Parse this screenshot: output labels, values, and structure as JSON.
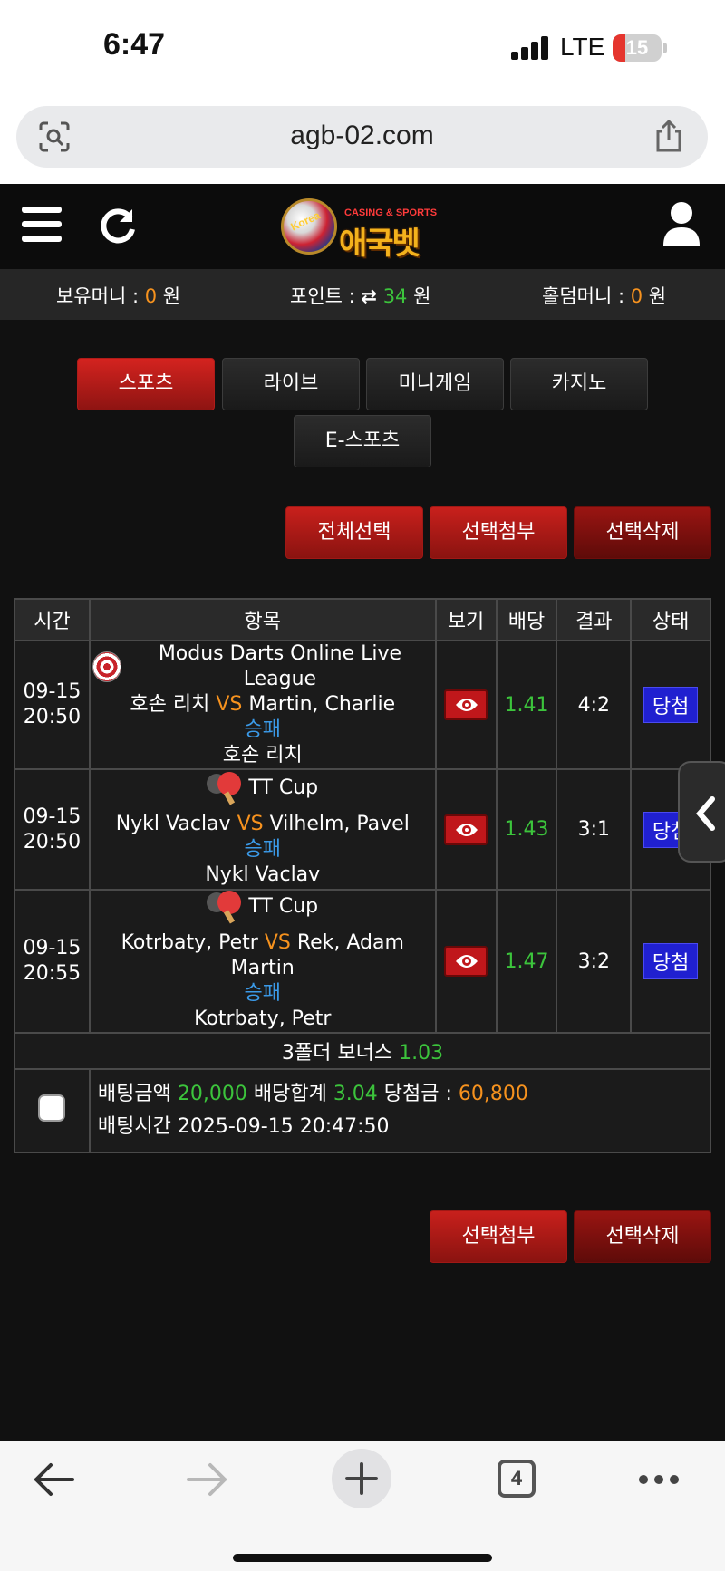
{
  "status_bar": {
    "time": "6:47",
    "network": "LTE",
    "battery": "15"
  },
  "browser": {
    "url": "agb-02.com",
    "tab_count": "4"
  },
  "logo": {
    "top_text": "CASING & SPORTS",
    "main_text": "애국벳",
    "ball_text": "Korea"
  },
  "money_bar": {
    "holding_label": "보유머니 : ",
    "holding_value": "0",
    "holding_unit": " 원",
    "point_label": "포인트 : ",
    "point_value": "34",
    "point_unit": " 원",
    "holdem_label": "홀덤머니 : ",
    "holdem_value": "0",
    "holdem_unit": " 원"
  },
  "tabs": [
    "스포츠",
    "라이브",
    "미니게임",
    "카지노",
    "E-스포츠"
  ],
  "actions_top": [
    "전체선택",
    "선택첨부",
    "선택삭제"
  ],
  "table": {
    "headers": [
      "시간",
      "항목",
      "보기",
      "배당",
      "결과",
      "상태"
    ],
    "rows": [
      {
        "date": "09-15",
        "time": "20:50",
        "league": "Modus Darts Online Live League",
        "home": "호손 리치",
        "vs": "VS",
        "away": "Martin, Charlie",
        "market": "승패",
        "pick": "호손 리치",
        "odds": "1.41",
        "result": "4:2",
        "status": "당첨"
      },
      {
        "date": "09-15",
        "time": "20:50",
        "league": "TT Cup",
        "home": "Nykl Vaclav",
        "vs": "VS",
        "away": "Vilhelm, Pavel",
        "market": "승패",
        "pick": "Nykl Vaclav",
        "odds": "1.43",
        "result": "3:1",
        "status": "당첨"
      },
      {
        "date": "09-15",
        "time": "20:55",
        "league": "TT Cup",
        "home": "Kotrbaty, Petr",
        "vs": "VS",
        "away": "Rek, Adam Martin",
        "market": "승패",
        "pick": "Kotrbaty, Petr",
        "odds": "1.47",
        "result": "3:2",
        "status": "당첨"
      }
    ],
    "bonus_label": "3폴더 보너스 ",
    "bonus_value": "1.03",
    "summary": {
      "amount_label": "배팅금액 ",
      "amount_value": "20,000",
      "total_label": " 배당합계 ",
      "total_value": "3.04",
      "win_label": " 당첨금 : ",
      "win_value": "60,800",
      "time_label": "배팅시간 ",
      "time_value": "2025-09-15 20:47:50"
    }
  },
  "actions_bottom": [
    "선택첨부",
    "선택삭제"
  ],
  "colors": {
    "accent_red": "#c8201c",
    "odds_green": "#3cc43c",
    "vs_orange": "#f6921e",
    "market_blue": "#3b9ae8",
    "status_blue": "#2020d0"
  }
}
